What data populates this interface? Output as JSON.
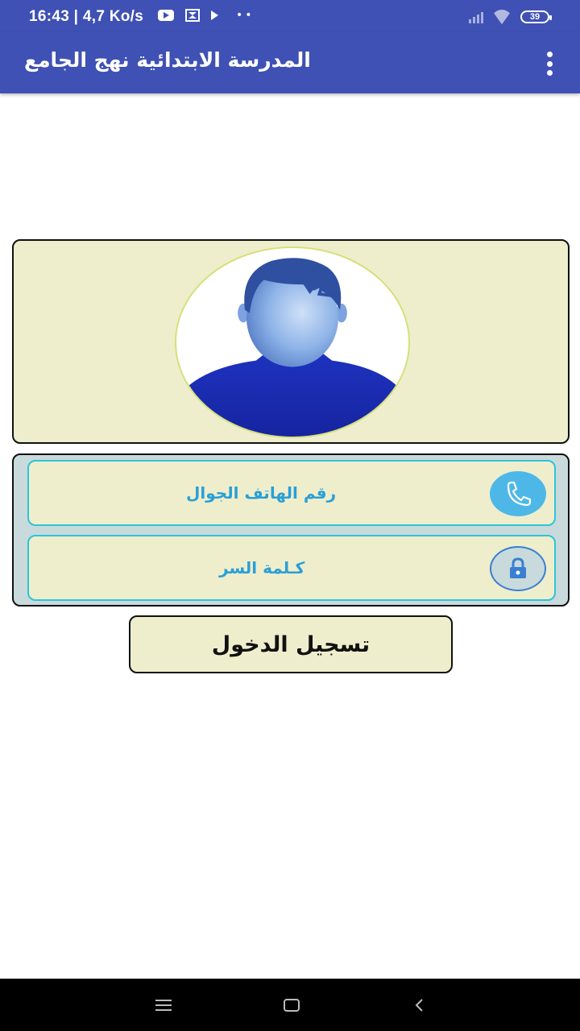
{
  "status_bar": {
    "time": "16:43 | 4,7 Ko/s",
    "battery": "39",
    "icons": [
      "youtube-icon",
      "app-icon",
      "play-icon",
      "more-dots-icon",
      "signal-icon",
      "wifi-icon",
      "battery-icon"
    ]
  },
  "app_bar": {
    "title": "المدرسة الابتدائية نهج الجامع",
    "menu_icon": "overflow-menu-icon"
  },
  "avatar": {
    "icon": "user-avatar-icon",
    "colors": {
      "panel_bg": "#eeeecd",
      "shirt": "#1a2fb0",
      "hair": "#2f4fa0",
      "face": "#8fb4e8"
    }
  },
  "form": {
    "phone_field": {
      "label": "رقم الهاتف الجوال",
      "icon": "phone-icon"
    },
    "password_field": {
      "label": "كـلمة السر",
      "icon": "lock-icon"
    }
  },
  "login_button": {
    "label": "تسجيل الدخول"
  },
  "nav_bar": {
    "buttons": [
      "menu-icon",
      "home-icon",
      "back-icon"
    ]
  },
  "colors": {
    "primary": "#3f51b5",
    "field_border": "#2ec4d8",
    "field_text": "#2b9fd6",
    "panel_bg": "#eeeecd"
  }
}
